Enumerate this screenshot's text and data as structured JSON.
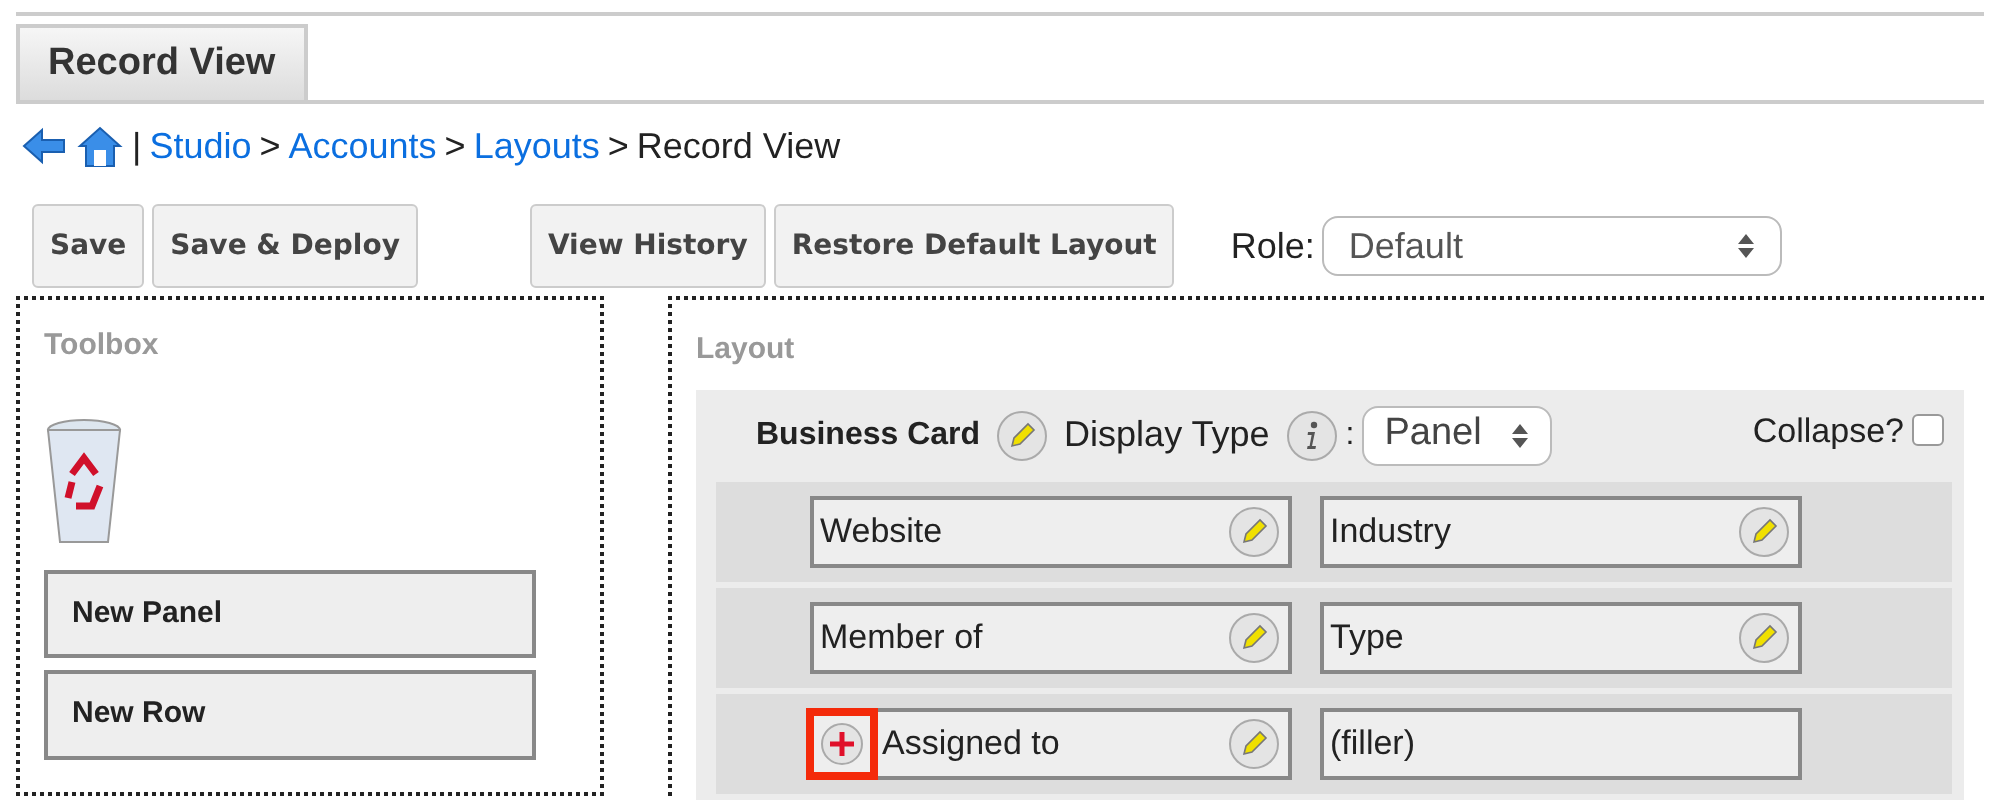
{
  "tabs": [
    {
      "label": "Record View",
      "selected": true
    }
  ],
  "breadcrumb": {
    "links": [
      "Studio",
      "Accounts",
      "Layouts"
    ],
    "separator": "|",
    "arrow": ">",
    "current": "Record View"
  },
  "toolbar": {
    "buttons": [
      "Save",
      "Save & Deploy"
    ],
    "buttons_right": [
      "View History",
      "Restore Default Layout"
    ],
    "role_label": "Role:",
    "role_value": "Default"
  },
  "toolbox": {
    "title": "Toolbox",
    "items": [
      "New Panel",
      "New Row"
    ]
  },
  "layout": {
    "title": "Layout",
    "panel": {
      "name": "Business Card",
      "display_type_label": "Display Type",
      "colon": ":",
      "display_type": "Panel",
      "collapse_label": "Collapse?",
      "collapse_checked": false,
      "rows": [
        [
          {
            "kind": "field",
            "label": "Website",
            "add_highlight": false
          },
          {
            "kind": "field",
            "label": "Industry",
            "add_highlight": false
          }
        ],
        [
          {
            "kind": "field",
            "label": "Member of",
            "add_highlight": false
          },
          {
            "kind": "field",
            "label": "Type",
            "add_highlight": false
          }
        ],
        [
          {
            "kind": "field",
            "label": "Assigned to",
            "add_highlight": true
          },
          {
            "kind": "filler",
            "label": "(filler)",
            "add_highlight": false
          }
        ]
      ]
    }
  }
}
